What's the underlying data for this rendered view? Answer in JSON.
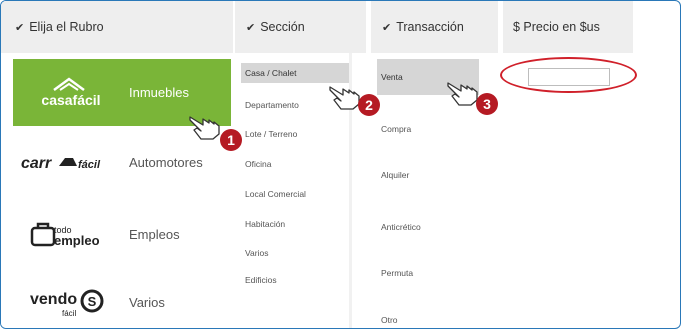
{
  "rubro": {
    "header": "Elija el Rubro",
    "items": [
      {
        "logo": "casafacil",
        "label": "Inmuebles",
        "selected": true
      },
      {
        "logo": "carrofacil",
        "label": "Automotores",
        "selected": false
      },
      {
        "logo": "todo empleo",
        "label": "Empleos",
        "selected": false
      },
      {
        "logo": "vendo fácil",
        "label": "Varios",
        "selected": false
      }
    ]
  },
  "seccion": {
    "header": "Sección",
    "items": [
      "Casa / Chalet",
      "Departamento",
      "Lote / Terreno",
      "Oficina",
      "Local Comercial",
      "Habitación",
      "Varios",
      "Edificios"
    ],
    "selected_index": 0
  },
  "transaccion": {
    "header": "Transacción",
    "items": [
      "Venta",
      "Compra",
      "Alquiler",
      "Anticrético",
      "Permuta",
      "Otro"
    ],
    "selected_index": 0
  },
  "precio": {
    "header": "$ Precio en $us",
    "value": ""
  },
  "steps": [
    "1",
    "2",
    "3"
  ],
  "colors": {
    "accent_green": "#7ab538",
    "badge_red": "#b51a23",
    "frame_blue": "#2a78b8"
  }
}
